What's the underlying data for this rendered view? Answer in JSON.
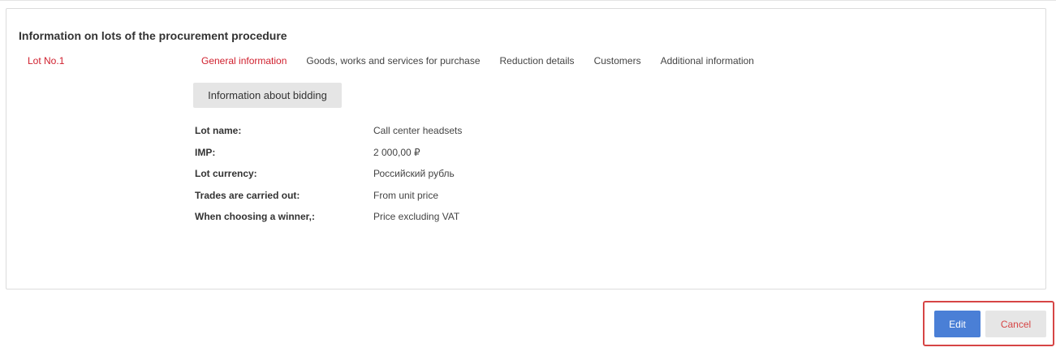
{
  "panel": {
    "title": "Information on lots of the procurement procedure"
  },
  "lots": [
    {
      "label": "Lot No.1"
    }
  ],
  "tabs": [
    {
      "label": "General information",
      "active": true
    },
    {
      "label": "Goods, works and services for purchase",
      "active": false
    },
    {
      "label": "Reduction details",
      "active": false
    },
    {
      "label": "Customers",
      "active": false
    },
    {
      "label": "Additional information",
      "active": false
    }
  ],
  "sub_tab": {
    "label": "Information about bidding"
  },
  "details": [
    {
      "label": "Lot name:",
      "value": "Call center headsets"
    },
    {
      "label": "IMP:",
      "value": "2 000,00 ₽"
    },
    {
      "label": "Lot currency:",
      "value": "Российский рубль"
    },
    {
      "label": "Trades are carried out:",
      "value": "From unit price"
    },
    {
      "label": "When choosing a winner,:",
      "value": "Price excluding VAT"
    }
  ],
  "actions": {
    "edit_label": "Edit",
    "cancel_label": "Cancel"
  },
  "colors": {
    "accent_red": "#d0202e",
    "edit_blue": "#4a7fd6",
    "highlight_frame": "#d64545"
  }
}
